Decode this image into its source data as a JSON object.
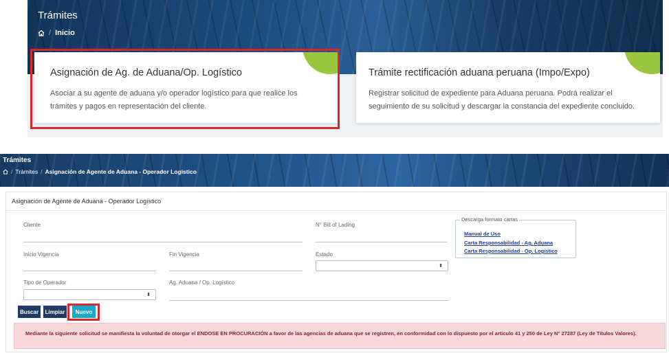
{
  "top": {
    "title": "Trámites",
    "breadcrumb": {
      "home_icon": "home-icon",
      "current": "Inicio"
    },
    "cards": [
      {
        "title": "Asignación de Ag. de Aduana/Op. Logístico",
        "description": "Asociar a su agente de aduana y/o operador logístico para que realice los trámites y pagos en representación del cliente.",
        "icon": "edit-document-icon"
      },
      {
        "title": "Trámite rectificación aduana peruana (Impo/Expo)",
        "description": "Registrar solicitud de expediente para Aduana peruana. Podrá realizar el seguimiento de su solicitud y descargar la constancia del expediente concluido.",
        "icon": "document-icon"
      }
    ]
  },
  "bottom": {
    "title": "Trámites",
    "breadcrumb": {
      "home_icon": "home-icon",
      "parent": "Trámites",
      "current": "Asignación de Agente de Aduana - Operador Logístico"
    },
    "form_title": "Asignación de Agente de Aduana - Operador Logístico",
    "fields": {
      "cliente": "Cliente",
      "bill_of_lading": "N° Bill of Lading",
      "inicio_vigencia": "Inicio Vigencia",
      "fin_vigencia": "Fin Vigencia",
      "estado": "Estado",
      "tipo_operador": "Tipo de Operador",
      "ag_aduana": "Ag. Aduana / Op. Logístico"
    },
    "downloads": {
      "legend": "Descarga formato cartas",
      "links": [
        "Manual de Uso",
        "Carta Responsabilidad - Ag. Aduana",
        "Carta Responsabilidad - Op. Logístico"
      ]
    },
    "buttons": {
      "buscar": "Buscar",
      "limpiar": "Limpiar",
      "nuevo": "Nuevo"
    },
    "alert": "Mediante la siguiente solicitud se manifiesta la voluntad de otorgar el ENDOSE EN PROCURACIÓN a favor de las agencias de aduana que se registren, en conformidad con lo dispuesto por el artículo 41 y 250 de Ley N° 27287 (Ley de Títulos Valores).",
    "select_caret": "⬍"
  },
  "colors": {
    "highlight": "#d9252b",
    "badge": "#9ac73f",
    "primary_button": "#1f3a64",
    "new_button": "#17a9c7",
    "alert_bg": "#f8d7da"
  }
}
